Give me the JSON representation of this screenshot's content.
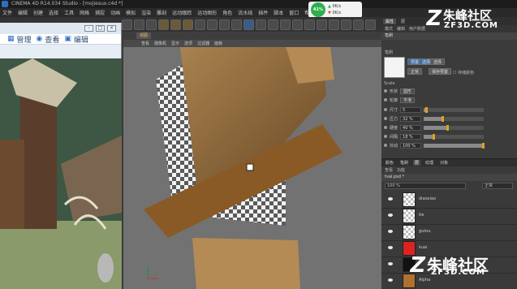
{
  "window": {
    "title": "CINEMA 4D R14.034 Studio - [mojiesuo.c4d *]"
  },
  "menu": {
    "items": [
      "文件",
      "编辑",
      "创建",
      "选择",
      "工具",
      "网格",
      "捕捉",
      "动画",
      "模拟",
      "渲染",
      "雕刻",
      "运动跟踪",
      "运动图形",
      "角色",
      "流水线",
      "插件",
      "脚本",
      "窗口",
      "帮助"
    ]
  },
  "perf": {
    "percent": "41%",
    "up": "0K/s",
    "down": "0K/s"
  },
  "explorer": {
    "tabs": [
      {
        "label": "管理",
        "icon": "grid-icon"
      },
      {
        "label": "查看",
        "icon": "eye-icon"
      },
      {
        "label": "编辑",
        "icon": "edit-icon"
      }
    ]
  },
  "viewport": {
    "tab_label": "视图",
    "menu": [
      "查看",
      "摄像机",
      "显示",
      "选项",
      "过滤器",
      "面板"
    ]
  },
  "right_panel": {
    "tabs": [
      "属性",
      "层"
    ],
    "sub_tabs": [
      "模式",
      "编辑",
      "用户数据"
    ],
    "section": "笔刷",
    "brush_label": "笔刷",
    "preset_button": "预置",
    "select_button": "选择",
    "extra_button": "选择",
    "mode_value": "正常",
    "mode_button": "保存预置",
    "store_color_label": "存储颜色",
    "scale_label": "Scale",
    "props": [
      {
        "label": "形状",
        "value": "圆形",
        "kind": "select"
      },
      {
        "label": "轮廓",
        "value": "平滑",
        "kind": "select"
      },
      {
        "label": "尺寸",
        "value": "5",
        "kind": "slider",
        "level": 0.06
      },
      {
        "label": "压力",
        "value": "32 %",
        "kind": "slider",
        "level": 0.32
      },
      {
        "label": "硬度",
        "value": "40 %",
        "kind": "slider",
        "level": 0.4
      },
      {
        "label": "间隔",
        "value": "18 %",
        "kind": "slider",
        "level": 0.18
      },
      {
        "label": "抖动",
        "value": "100 %",
        "kind": "slider",
        "level": 1.0
      }
    ]
  },
  "layers": {
    "tabs": [
      "颜色",
      "笔刷",
      "层",
      "纹理",
      "对象"
    ],
    "sub": [
      "查看",
      "功能"
    ],
    "file": "tval.psd *",
    "blend": "正常",
    "opacity": "100 %",
    "rows": [
      {
        "name": "diaoxiao",
        "thumb": "checker"
      },
      {
        "name": "tie",
        "thumb": "checker"
      },
      {
        "name": "gutou",
        "thumb": "checker"
      },
      {
        "name": "kuai",
        "thumb": "red"
      },
      {
        "name": "",
        "thumb": "dark"
      },
      {
        "name": "Alpha",
        "thumb": "orange"
      }
    ]
  },
  "watermark": {
    "name": "朱峰社区",
    "url": "ZF3D.COM"
  }
}
